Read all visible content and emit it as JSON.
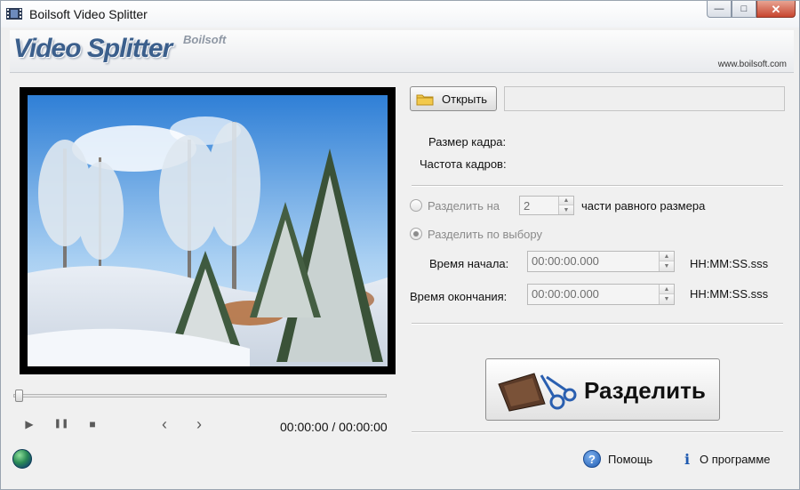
{
  "window": {
    "title": "Boilsoft Video Splitter",
    "minimize_glyph": "—",
    "maximize_glyph": "□",
    "close_glyph": "✕"
  },
  "banner": {
    "logo": "Video Splitter",
    "logo_sub": "Boilsoft",
    "website": "www.boilsoft.com"
  },
  "player": {
    "time_display": "00:00:00 / 00:00:00",
    "play_glyph": "▶",
    "pause_glyph": "❚❚",
    "stop_glyph": "■",
    "prev_glyph": "‹",
    "next_glyph": "›",
    "position": 0
  },
  "file": {
    "open_label": "Открыть",
    "path_value": ""
  },
  "info": {
    "frame_size_label": "Размер кадра:",
    "frame_rate_label": "Частота кадров:"
  },
  "split_options": {
    "equal_label": "Разделить на",
    "equal_count": "2",
    "equal_suffix": "части равного размера",
    "custom_label": "Разделить по выбору",
    "start_label": "Время начала:",
    "start_value": "00:00:00.000",
    "end_label": "Время окончания:",
    "end_value": "00:00:00.000",
    "time_format": "HH:MM:SS.sss",
    "spin_up": "▲",
    "spin_down": "▼"
  },
  "actions": {
    "split_label": "Разделить",
    "help_label": "Помощь",
    "about_label": "О программе",
    "help_glyph": "?",
    "info_glyph": "i"
  },
  "colors": {
    "logo": "#3b5f8c",
    "close_button": "#c7452e",
    "window_bg": "#f0f0f0"
  }
}
